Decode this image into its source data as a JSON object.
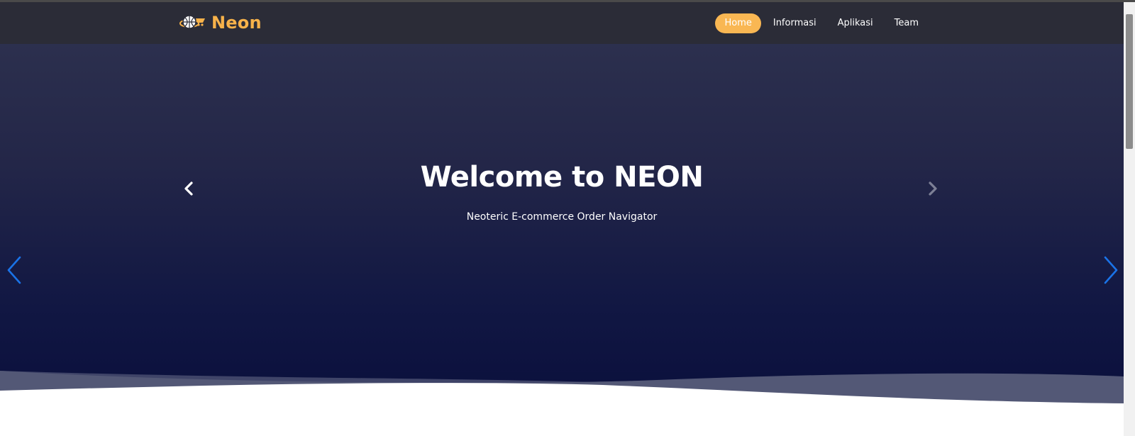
{
  "navbar": {
    "brand_name": "Neon",
    "brand_icon": "globe-cart-icon",
    "items": [
      {
        "label": "Home",
        "active": true
      },
      {
        "label": "Informasi",
        "active": false
      },
      {
        "label": "Aplikasi",
        "active": false
      },
      {
        "label": "Team",
        "active": false
      }
    ]
  },
  "hero": {
    "title": "Welcome to NEON",
    "subtitle": "Neoteric E-commerce Order Navigator"
  },
  "controls": {
    "inner_prev_icon": "chevron-left-icon",
    "inner_next_icon": "chevron-right-icon",
    "outer_prev_icon": "chevron-left-icon",
    "outer_next_icon": "chevron-right-icon"
  },
  "colors": {
    "accent": "#f9b753",
    "brand": "#f7b24a",
    "navbar_bg": "#2b2c37",
    "hero_top": "#2f3350",
    "hero_bottom": "#0a0f3c",
    "outer_arrow": "#1a73e8"
  }
}
